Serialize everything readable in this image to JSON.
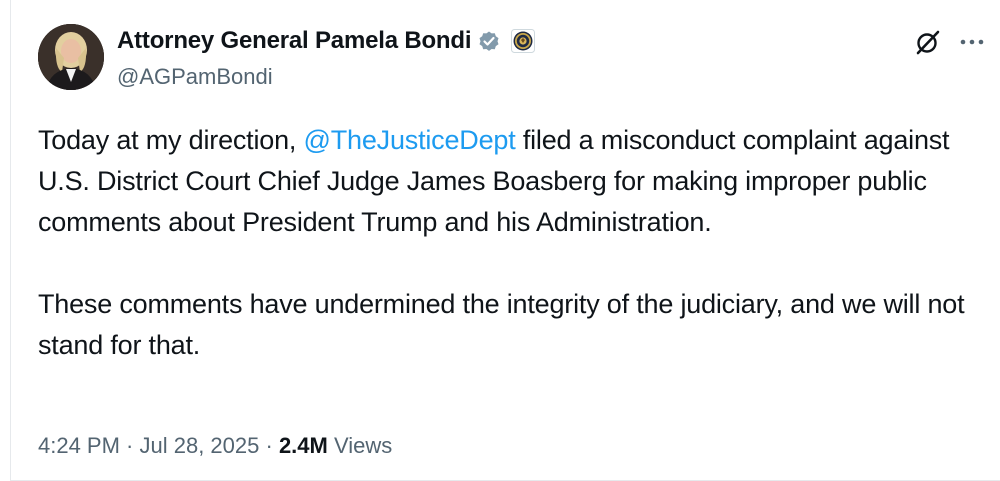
{
  "tweet": {
    "author": {
      "display_name": "Attorney General Pamela Bondi",
      "handle": "@AGPamBondi",
      "verified_badge": "gray-checkmark-icon",
      "affiliation_badge": "doj-seal-icon"
    },
    "header_icons": {
      "grok": "grok-icon",
      "more": "more-options-icon"
    },
    "body": {
      "p1_before": "Today at my direction, ",
      "p1_mention": "@TheJusticeDept",
      "p1_after": " filed a misconduct complaint against U.S. District Court Chief Judge James Boasberg for making improper public comments about President Trump and his Administration.",
      "p2": "These comments have undermined the integrity of the judiciary, and we will not stand for that."
    },
    "meta": {
      "time": "4:24 PM",
      "separator": " · ",
      "date": "Jul 28, 2025",
      "views_count": "2.4M",
      "views_label": " Views"
    },
    "colors": {
      "text": "#0f1419",
      "secondary": "#536471",
      "link": "#1d9bf0",
      "verified_gray": "#829aab"
    }
  }
}
